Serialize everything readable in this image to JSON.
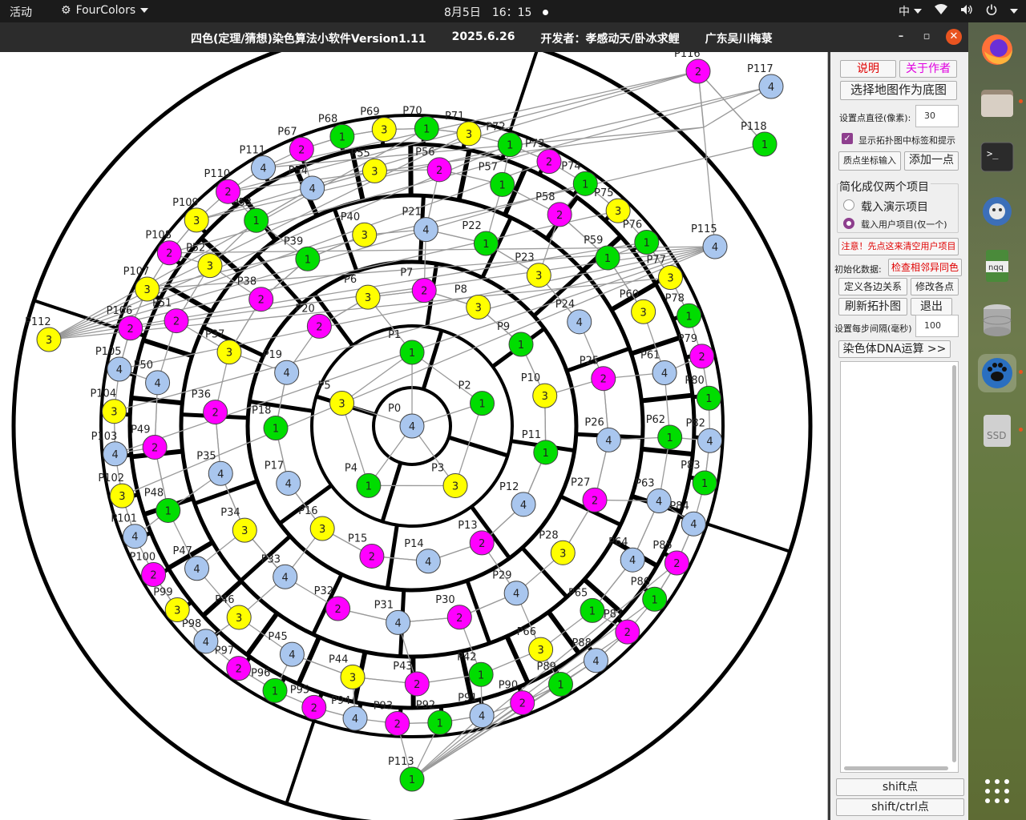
{
  "topbar": {
    "activities": "活动",
    "app_name": "FourColors",
    "date": "8月5日",
    "time": "16：15",
    "input_method": "中"
  },
  "window": {
    "title": "四色(定理/猜想)染色算法小软件Version1.11",
    "date": "2025.6.26",
    "developer": "开发者：孝感动天/卧冰求鲤",
    "location": "广东吴川梅菉"
  },
  "panel": {
    "btn_help": "说明",
    "btn_about": "关于作者",
    "btn_select_map": "选择地图作为底图",
    "label_diameter": "设置点直径(像素):",
    "diameter_value": "30",
    "label_show_labels": "显示拓扑图中标签和提示",
    "btn_coord_input": "质点坐标输入",
    "btn_add_point": "添加一点",
    "group_title": "简化成仅两个项目",
    "radio_demo": "载入演示项目",
    "radio_user": "载入用户项目(仅一个)",
    "warning": "注意！先点这来清空用户项目",
    "label_init": "初始化数据:",
    "btn_check_adjacent": "检查相邻异同色",
    "btn_define_edges": "定义各边关系",
    "btn_modify_points": "修改各点",
    "btn_refresh": "刷新拓扑图",
    "btn_exit": "退出",
    "label_interval": "设置每步间隔(毫秒)",
    "interval_value": "100",
    "btn_dna": "染色体DNA运算 >>",
    "btn_shift": "shift点",
    "btn_shift_ctrl": "shift/ctrl点"
  },
  "colors": {
    "c1": "#00dd00",
    "c2": "#ff00ff",
    "c3": "#ffff00",
    "c4": "#a9c6ee",
    "accent": "#e95420"
  },
  "nodes": [
    {
      "l": "P0",
      "c": 4
    },
    {
      "l": "P1",
      "c": 1
    },
    {
      "l": "P2",
      "c": 1
    },
    {
      "l": "P3",
      "c": 3
    },
    {
      "l": "P4",
      "c": 1
    },
    {
      "l": "P5",
      "c": 3
    },
    {
      "l": "P6",
      "c": 3
    },
    {
      "l": "P7",
      "c": 2
    },
    {
      "l": "P8",
      "c": 3
    },
    {
      "l": "P9",
      "c": 1
    },
    {
      "l": "P10",
      "c": 3
    },
    {
      "l": "P11",
      "c": 1
    },
    {
      "l": "P12",
      "c": 4
    },
    {
      "l": "P13",
      "c": 2
    },
    {
      "l": "P14",
      "c": 4
    },
    {
      "l": "P15",
      "c": 2
    },
    {
      "l": "P16",
      "c": 3
    },
    {
      "l": "P17",
      "c": 4
    },
    {
      "l": "P18",
      "c": 1
    },
    {
      "l": "P19",
      "c": 4
    },
    {
      "l": "P20",
      "c": 2
    },
    {
      "l": "P21",
      "c": 4
    },
    {
      "l": "P22",
      "c": 1
    },
    {
      "l": "P23",
      "c": 3
    },
    {
      "l": "P24",
      "c": 4
    },
    {
      "l": "P25",
      "c": 2
    },
    {
      "l": "P26",
      "c": 4
    },
    {
      "l": "P27",
      "c": 2
    },
    {
      "l": "P28",
      "c": 3
    },
    {
      "l": "P29",
      "c": 4
    },
    {
      "l": "P30",
      "c": 2
    },
    {
      "l": "P31",
      "c": 4
    },
    {
      "l": "P32",
      "c": 2
    },
    {
      "l": "P33",
      "c": 4
    },
    {
      "l": "P34",
      "c": 3
    },
    {
      "l": "P35",
      "c": 4
    },
    {
      "l": "P36",
      "c": 2
    },
    {
      "l": "P37",
      "c": 3
    },
    {
      "l": "P38",
      "c": 2
    },
    {
      "l": "P39",
      "c": 1
    },
    {
      "l": "P40",
      "c": 3
    },
    {
      "l": "P42",
      "c": 1
    },
    {
      "l": "P43",
      "c": 2
    },
    {
      "l": "P44",
      "c": 3
    },
    {
      "l": "P45",
      "c": 4
    },
    {
      "l": "P46",
      "c": 3
    },
    {
      "l": "P47",
      "c": 4
    },
    {
      "l": "P48",
      "c": 1
    },
    {
      "l": "P49",
      "c": 2
    },
    {
      "l": "P50",
      "c": 4
    },
    {
      "l": "P51",
      "c": 2
    },
    {
      "l": "P52",
      "c": 3
    },
    {
      "l": "P53",
      "c": 1
    },
    {
      "l": "P54",
      "c": 4
    },
    {
      "l": "P55",
      "c": 3
    },
    {
      "l": "P56",
      "c": 2
    },
    {
      "l": "P57",
      "c": 1
    },
    {
      "l": "P58",
      "c": 2
    },
    {
      "l": "P59",
      "c": 1
    },
    {
      "l": "P60",
      "c": 3
    },
    {
      "l": "P61",
      "c": 4
    },
    {
      "l": "P62",
      "c": 1
    },
    {
      "l": "P63",
      "c": 4
    },
    {
      "l": "P64",
      "c": 4
    },
    {
      "l": "P65",
      "c": 1
    },
    {
      "l": "P66",
      "c": 3
    },
    {
      "l": "P67",
      "c": 2
    },
    {
      "l": "P68",
      "c": 1
    },
    {
      "l": "P69",
      "c": 3
    },
    {
      "l": "P70",
      "c": 1
    },
    {
      "l": "P71",
      "c": 3
    },
    {
      "l": "P72",
      "c": 1
    },
    {
      "l": "P73",
      "c": 2
    },
    {
      "l": "P74",
      "c": 1
    },
    {
      "l": "P75",
      "c": 3
    },
    {
      "l": "P76",
      "c": 1
    },
    {
      "l": "P77",
      "c": 3
    },
    {
      "l": "P78",
      "c": 1
    },
    {
      "l": "P79",
      "c": 2
    },
    {
      "l": "P80",
      "c": 1
    },
    {
      "l": "P82",
      "c": 4
    },
    {
      "l": "P83",
      "c": 1
    },
    {
      "l": "P84",
      "c": 4
    },
    {
      "l": "P85",
      "c": 2
    },
    {
      "l": "P86",
      "c": 1
    },
    {
      "l": "P87",
      "c": 2
    },
    {
      "l": "P88",
      "c": 4
    },
    {
      "l": "P89",
      "c": 1
    },
    {
      "l": "P90",
      "c": 2
    },
    {
      "l": "P91",
      "c": 4
    },
    {
      "l": "P92",
      "c": 1
    },
    {
      "l": "P93",
      "c": 2
    },
    {
      "l": "P94",
      "c": 4
    },
    {
      "l": "P95",
      "c": 2
    },
    {
      "l": "P96",
      "c": 1
    },
    {
      "l": "P97",
      "c": 2
    },
    {
      "l": "P98",
      "c": 4
    },
    {
      "l": "P99",
      "c": 3
    },
    {
      "l": "P100",
      "c": 2
    },
    {
      "l": "P101",
      "c": 4
    },
    {
      "l": "P102",
      "c": 3
    },
    {
      "l": "P103",
      "c": 4
    },
    {
      "l": "P104",
      "c": 3
    },
    {
      "l": "P105",
      "c": 4
    },
    {
      "l": "P106",
      "c": 2
    },
    {
      "l": "P107",
      "c": 3
    },
    {
      "l": "P108",
      "c": 2
    },
    {
      "l": "P109",
      "c": 3
    },
    {
      "l": "P110",
      "c": 2
    },
    {
      "l": "P111",
      "c": 4
    },
    {
      "l": "P112",
      "c": 3
    },
    {
      "l": "P113",
      "c": 1
    },
    {
      "l": "P115",
      "c": 4
    },
    {
      "l": "P116",
      "c": 2
    },
    {
      "l": "P117",
      "c": 4
    },
    {
      "l": "P118",
      "c": 1
    }
  ]
}
